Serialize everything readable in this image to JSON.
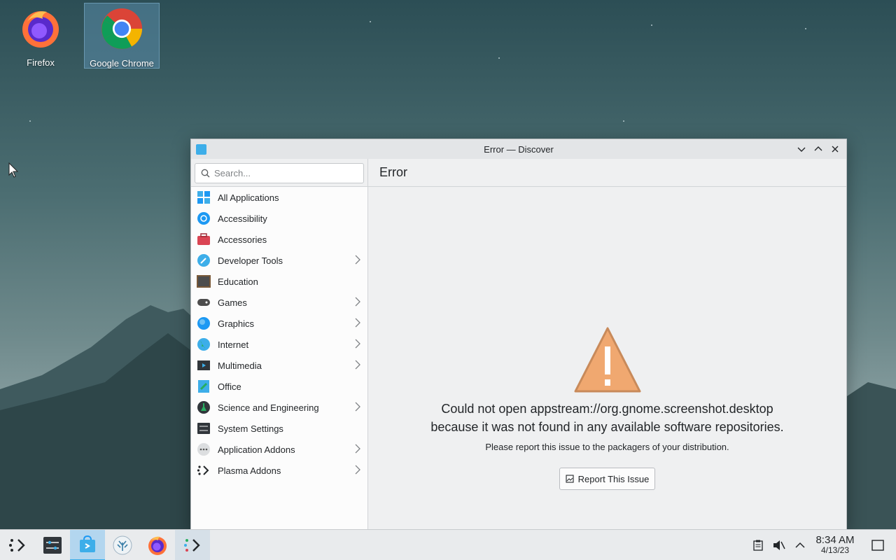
{
  "desktop": {
    "icons": [
      {
        "label": "Firefox"
      },
      {
        "label": "Google Chrome"
      }
    ]
  },
  "window": {
    "title": "Error — Discover",
    "search_placeholder": "Search...",
    "page_title": "Error",
    "categories": [
      {
        "label": "All Applications",
        "icon": "grid-icon",
        "chevron": false
      },
      {
        "label": "Accessibility",
        "icon": "accessibility-icon",
        "chevron": false
      },
      {
        "label": "Accessories",
        "icon": "toolbox-icon",
        "chevron": false
      },
      {
        "label": "Developer Tools",
        "icon": "wrench-icon",
        "chevron": true
      },
      {
        "label": "Education",
        "icon": "chalkboard-icon",
        "chevron": false
      },
      {
        "label": "Games",
        "icon": "gamepad-icon",
        "chevron": true
      },
      {
        "label": "Graphics",
        "icon": "graphics-icon",
        "chevron": true
      },
      {
        "label": "Internet",
        "icon": "globe-icon",
        "chevron": true
      },
      {
        "label": "Multimedia",
        "icon": "multimedia-icon",
        "chevron": true
      },
      {
        "label": "Office",
        "icon": "office-icon",
        "chevron": false
      },
      {
        "label": "Science and Engineering",
        "icon": "flask-icon",
        "chevron": true
      },
      {
        "label": "System Settings",
        "icon": "settings-icon",
        "chevron": false
      },
      {
        "label": "Application Addons",
        "icon": "addons-icon",
        "chevron": true
      },
      {
        "label": "Plasma Addons",
        "icon": "plasma-icon",
        "chevron": true
      }
    ],
    "error": {
      "message_line1": "Could not open appstream://org.gnome.screenshot.desktop",
      "message_line2": "because it was not found in any available software repositories.",
      "hint": "Please report this issue to the packagers of your distribution.",
      "report_button": "Report This Issue"
    }
  },
  "taskbar": {
    "time": "8:34 AM",
    "date": "4/13/23"
  },
  "colors": {
    "accent": "#3daee9",
    "warning": "#f0a870"
  }
}
